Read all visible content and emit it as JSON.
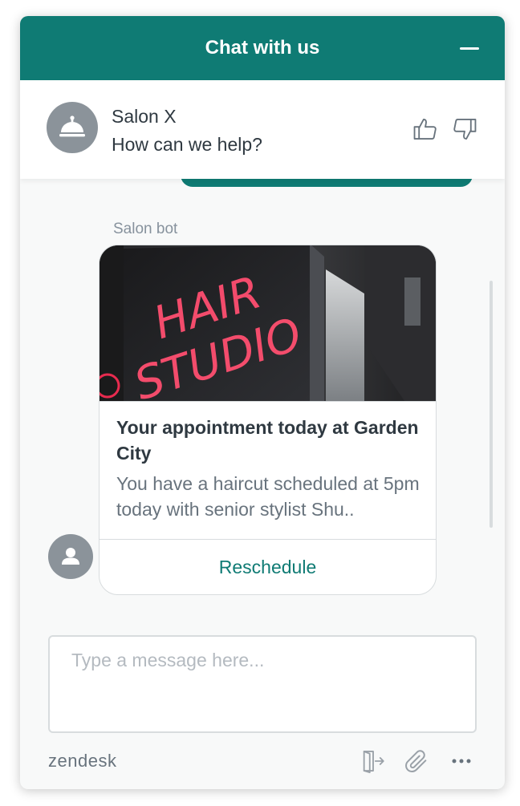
{
  "header": {
    "title": "Chat with us",
    "minimize_icon": "minus-icon"
  },
  "agent": {
    "name": "Salon X",
    "status": "How can we help?",
    "avatar_icon": "service-bell-icon",
    "rate_up_icon": "thumbs-up-icon",
    "rate_down_icon": "thumbs-down-icon"
  },
  "message": {
    "sender": "Salon bot",
    "card": {
      "image_sign_lines": [
        "HAIR",
        "STUDIO"
      ],
      "title": "Your appointment today at Garden City",
      "description": "You have a haircut scheduled at 5pm today with senior stylist Shu..",
      "action_label": "Reschedule"
    },
    "avatar_icon": "user-icon"
  },
  "composer": {
    "placeholder": "Type a message here..."
  },
  "footer": {
    "brand": "zendesk",
    "end_chat_icon": "end-chat-icon",
    "attach_icon": "paperclip-icon",
    "more_icon": "more-options-icon"
  },
  "colors": {
    "primary": "#0f7b74",
    "text": "#2f3941",
    "muted": "#68737d",
    "neon": "#ff2e55"
  }
}
